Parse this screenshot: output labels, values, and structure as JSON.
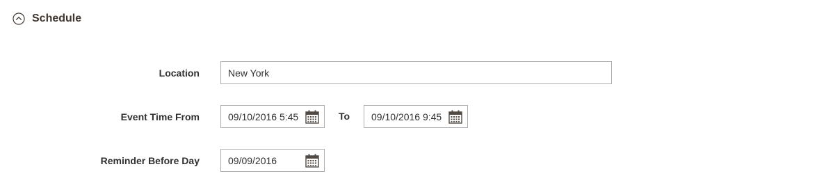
{
  "section": {
    "title": "Schedule",
    "icon": "collapse-up-icon"
  },
  "fields": {
    "location": {
      "label": "Location",
      "value": "New York"
    },
    "event_time": {
      "label": "Event Time From",
      "from_value": "09/10/2016 5:45",
      "to_label": "To",
      "to_value": "09/10/2016 9:45"
    },
    "reminder": {
      "label": "Reminder Before Day",
      "value": "09/09/2016"
    }
  },
  "icons": {
    "calendar": "calendar-icon"
  },
  "colors": {
    "border": "#adadad",
    "text": "#303030",
    "title": "#41362f"
  }
}
